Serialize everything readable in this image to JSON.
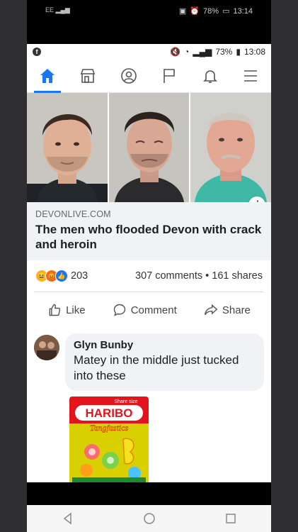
{
  "outer_status": {
    "carrier": "EE",
    "battery": "78%",
    "time": "13:14"
  },
  "inner_status": {
    "battery": "73%",
    "time": "13:08"
  },
  "nav_tabs": [
    "home",
    "marketplace",
    "profile",
    "pages",
    "notifications",
    "menu"
  ],
  "post": {
    "domain": "DEVONLIVE.COM",
    "title": "The men who flooded Devon with crack and heroin",
    "reaction_count": "203",
    "comments": "307 comments",
    "shares": "161 shares",
    "separator": "•"
  },
  "actions": {
    "like": "Like",
    "comment": "Comment",
    "share": "Share"
  },
  "comment": {
    "author": "Glyn Bunby",
    "text": "Matey in the middle  just tucked into these",
    "sticker": {
      "brand": "HARIBO",
      "product": "Tangfastics",
      "tag": "Share size"
    }
  },
  "colors": {
    "facebook_blue": "#1877f2",
    "link_bg": "#f0f2f5",
    "haribo_red": "#e3141b"
  }
}
